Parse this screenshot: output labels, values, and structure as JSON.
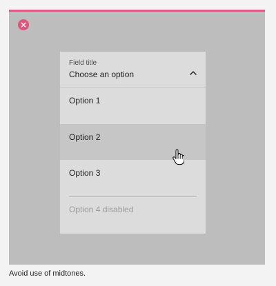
{
  "status": {
    "error_icon_symbol": "×",
    "accent_color": "#e45a83"
  },
  "dropdown": {
    "field_title": "Field title",
    "selected_value": "Choose an option",
    "options": [
      {
        "label": "Option 1",
        "disabled": false
      },
      {
        "label": "Option 2",
        "disabled": false,
        "hovered": true
      },
      {
        "label": "Option 3",
        "disabled": false
      },
      {
        "label": "Option 4 disabled",
        "disabled": true
      }
    ],
    "expanded": true
  },
  "caption": "Avoid use of midtones."
}
